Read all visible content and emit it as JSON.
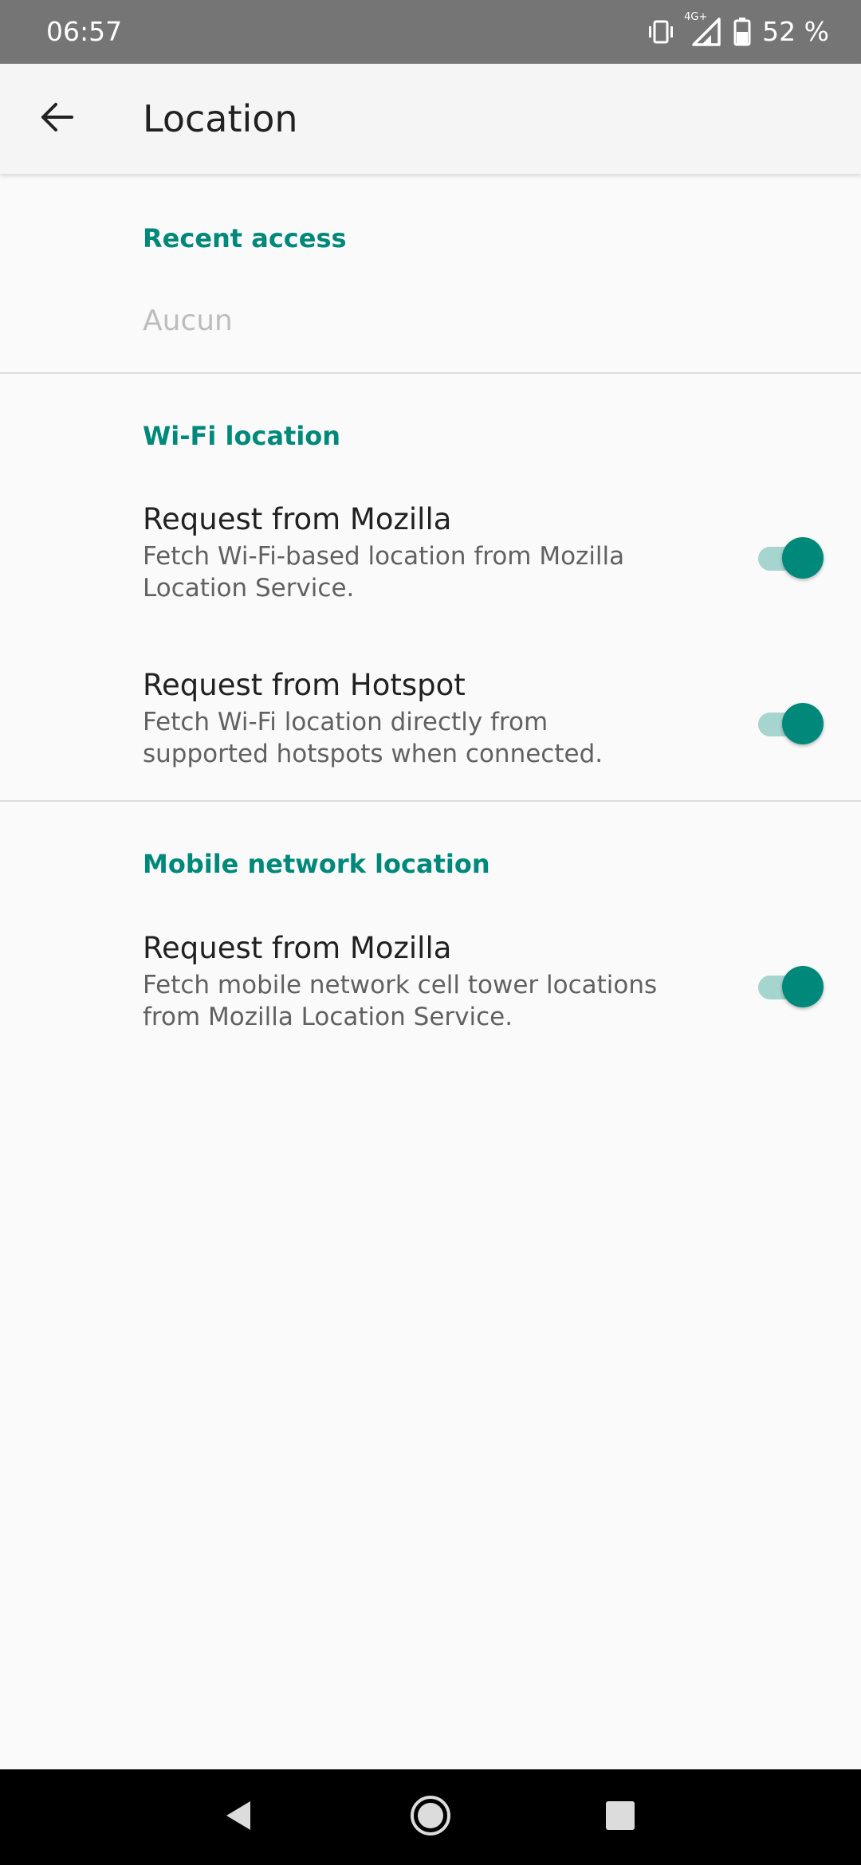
{
  "status_bar": {
    "time": "06:57",
    "network": "4G+",
    "battery": "52 %"
  },
  "toolbar": {
    "title": "Location"
  },
  "sections": {
    "recent": {
      "title": "Recent access",
      "empty_text": "Aucun"
    },
    "wifi": {
      "title": "Wi-Fi location",
      "items": [
        {
          "title": "Request from Mozilla",
          "summary": "Fetch Wi-Fi-based location from Mozilla Location Service.",
          "enabled": true
        },
        {
          "title": "Request from Hotspot",
          "summary": "Fetch Wi-Fi location directly from supported hotspots when connected.",
          "enabled": true
        }
      ]
    },
    "mobile": {
      "title": "Mobile network location",
      "items": [
        {
          "title": "Request from Mozilla",
          "summary": "Fetch mobile network cell tower locations from Mozilla Location Service.",
          "enabled": true
        }
      ]
    }
  },
  "colors": {
    "accent": "#00897b",
    "switch_track": "#a6d4ce",
    "status_bar": "#757575",
    "nav_bar": "#000000"
  },
  "icons": {
    "back": "arrow-back-icon",
    "vibrate": "vibrate-icon",
    "signal": "signal-icon",
    "battery": "battery-icon",
    "nav_back": "nav-back-icon",
    "nav_home": "nav-home-icon",
    "nav_recents": "nav-recents-icon"
  }
}
